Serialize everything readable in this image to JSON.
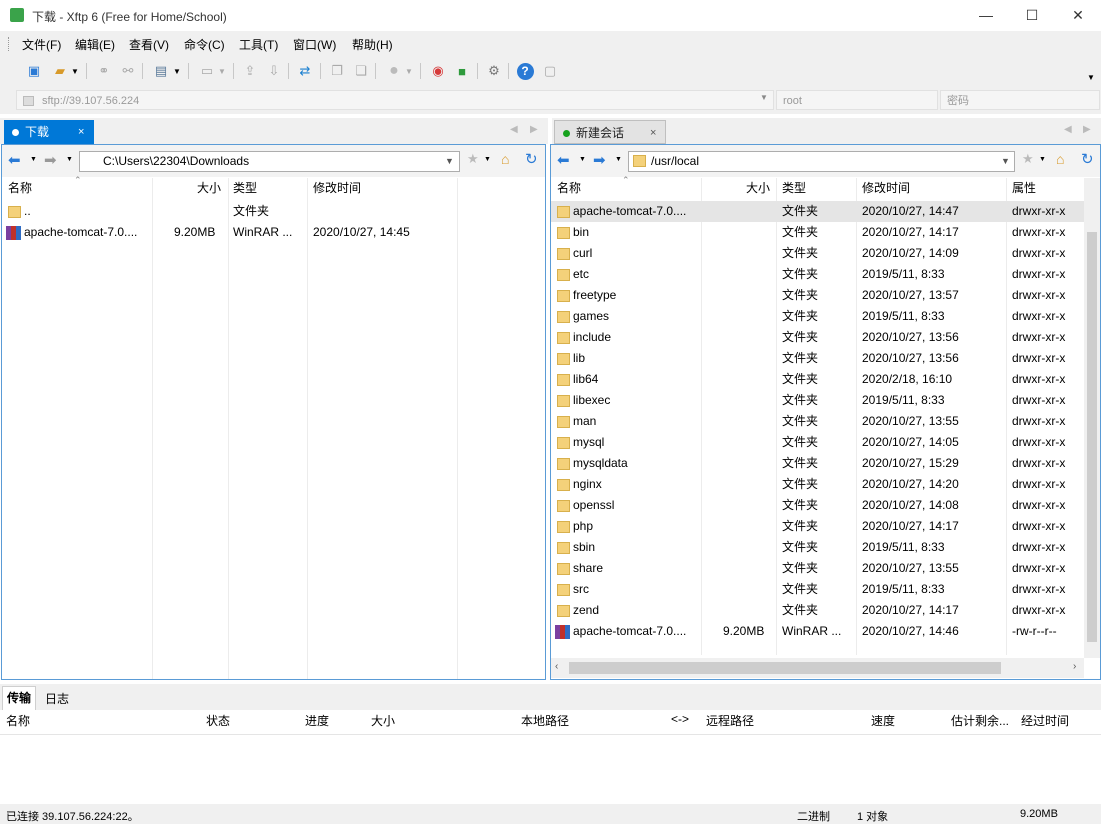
{
  "window": {
    "title": "下载 - Xftp 6 (Free for Home/School)",
    "minimize": "—",
    "maximize": "☐",
    "close": "✕"
  },
  "menu": [
    "文件(F)",
    "编辑(E)",
    "查看(V)",
    "命令(C)",
    "工具(T)",
    "窗口(W)",
    "帮助(H)"
  ],
  "address": {
    "host": "sftp://39.107.56.224",
    "user": "root",
    "password_placeholder": "密码"
  },
  "left_tab": {
    "label": "下载",
    "close": "×"
  },
  "right_tab": {
    "label": "新建会话",
    "close": "×"
  },
  "left_pane": {
    "path": "C:\\Users\\22304\\Downloads",
    "headers": {
      "name": "名称",
      "size": "大小",
      "type": "类型",
      "modified": "修改时间"
    },
    "rows": [
      {
        "name": "..",
        "size": "",
        "type": "文件夹",
        "modified": "",
        "icon": "folder"
      },
      {
        "name": "apache-tomcat-7.0....",
        "size": "9.20MB",
        "type": "WinRAR ...",
        "modified": "2020/10/27, 14:45",
        "icon": "rar"
      }
    ]
  },
  "right_pane": {
    "path": "/usr/local",
    "headers": {
      "name": "名称",
      "size": "大小",
      "type": "类型",
      "modified": "修改时间",
      "attr": "属性"
    },
    "rows": [
      {
        "name": "apache-tomcat-7.0....",
        "size": "",
        "type": "文件夹",
        "modified": "2020/10/27, 14:47",
        "attr": "drwxr-xr-x",
        "icon": "folder"
      },
      {
        "name": "bin",
        "size": "",
        "type": "文件夹",
        "modified": "2020/10/27, 14:17",
        "attr": "drwxr-xr-x",
        "icon": "folder"
      },
      {
        "name": "curl",
        "size": "",
        "type": "文件夹",
        "modified": "2020/10/27, 14:09",
        "attr": "drwxr-xr-x",
        "icon": "folder"
      },
      {
        "name": "etc",
        "size": "",
        "type": "文件夹",
        "modified": "2019/5/11, 8:33",
        "attr": "drwxr-xr-x",
        "icon": "folder"
      },
      {
        "name": "freetype",
        "size": "",
        "type": "文件夹",
        "modified": "2020/10/27, 13:57",
        "attr": "drwxr-xr-x",
        "icon": "folder"
      },
      {
        "name": "games",
        "size": "",
        "type": "文件夹",
        "modified": "2019/5/11, 8:33",
        "attr": "drwxr-xr-x",
        "icon": "folder"
      },
      {
        "name": "include",
        "size": "",
        "type": "文件夹",
        "modified": "2020/10/27, 13:56",
        "attr": "drwxr-xr-x",
        "icon": "folder"
      },
      {
        "name": "lib",
        "size": "",
        "type": "文件夹",
        "modified": "2020/10/27, 13:56",
        "attr": "drwxr-xr-x",
        "icon": "folder"
      },
      {
        "name": "lib64",
        "size": "",
        "type": "文件夹",
        "modified": "2020/2/18, 16:10",
        "attr": "drwxr-xr-x",
        "icon": "folder"
      },
      {
        "name": "libexec",
        "size": "",
        "type": "文件夹",
        "modified": "2019/5/11, 8:33",
        "attr": "drwxr-xr-x",
        "icon": "folder"
      },
      {
        "name": "man",
        "size": "",
        "type": "文件夹",
        "modified": "2020/10/27, 13:55",
        "attr": "drwxr-xr-x",
        "icon": "folder"
      },
      {
        "name": "mysql",
        "size": "",
        "type": "文件夹",
        "modified": "2020/10/27, 14:05",
        "attr": "drwxr-xr-x",
        "icon": "folder"
      },
      {
        "name": "mysqldata",
        "size": "",
        "type": "文件夹",
        "modified": "2020/10/27, 15:29",
        "attr": "drwxr-xr-x",
        "icon": "folder"
      },
      {
        "name": "nginx",
        "size": "",
        "type": "文件夹",
        "modified": "2020/10/27, 14:20",
        "attr": "drwxr-xr-x",
        "icon": "folder"
      },
      {
        "name": "openssl",
        "size": "",
        "type": "文件夹",
        "modified": "2020/10/27, 14:08",
        "attr": "drwxr-xr-x",
        "icon": "folder"
      },
      {
        "name": "php",
        "size": "",
        "type": "文件夹",
        "modified": "2020/10/27, 14:17",
        "attr": "drwxr-xr-x",
        "icon": "folder"
      },
      {
        "name": "sbin",
        "size": "",
        "type": "文件夹",
        "modified": "2019/5/11, 8:33",
        "attr": "drwxr-xr-x",
        "icon": "folder"
      },
      {
        "name": "share",
        "size": "",
        "type": "文件夹",
        "modified": "2020/10/27, 13:55",
        "attr": "drwxr-xr-x",
        "icon": "folder"
      },
      {
        "name": "src",
        "size": "",
        "type": "文件夹",
        "modified": "2019/5/11, 8:33",
        "attr": "drwxr-xr-x",
        "icon": "folder"
      },
      {
        "name": "zend",
        "size": "",
        "type": "文件夹",
        "modified": "2020/10/27, 14:17",
        "attr": "drwxr-xr-x",
        "icon": "folder"
      },
      {
        "name": "apache-tomcat-7.0....",
        "size": "9.20MB",
        "type": "WinRAR ...",
        "modified": "2020/10/27, 14:46",
        "attr": "-rw-r--r--",
        "icon": "rar"
      }
    ]
  },
  "transfer": {
    "tabs": [
      "传输",
      "日志"
    ],
    "headers": [
      "名称",
      "状态",
      "进度",
      "大小",
      "本地路径",
      "<->",
      "远程路径",
      "速度",
      "估计剩余...",
      "经过时间"
    ]
  },
  "status": {
    "connection": "已连接 39.107.56.224:22。",
    "mode": "二进制",
    "count": "1 对象",
    "size": "9.20MB"
  },
  "colors": {
    "accent": "#0078d7",
    "pane_border": "#5a9bd6",
    "folder": "#f4d17a",
    "connected": "#16a21d"
  }
}
